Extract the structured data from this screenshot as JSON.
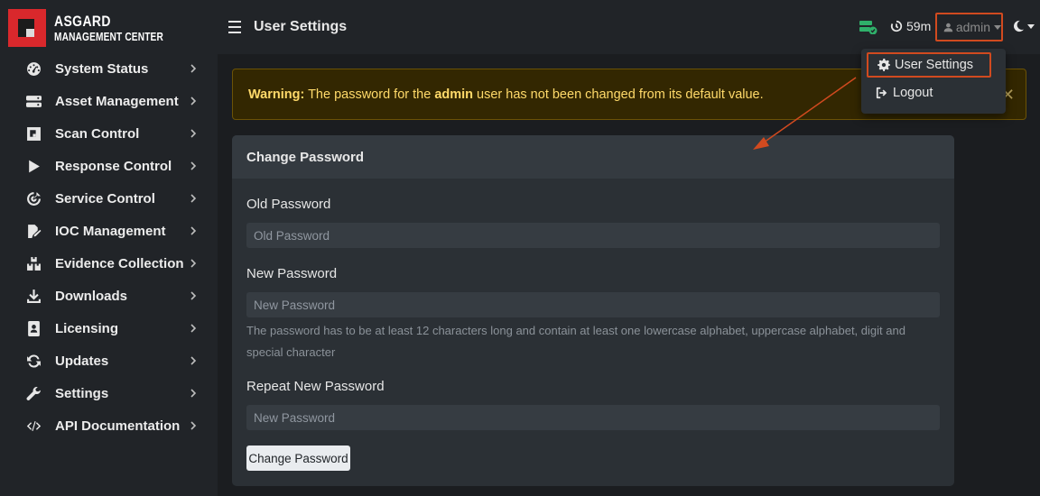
{
  "brand": {
    "line1": "ASGARD",
    "line2": "MANAGEMENT CENTER"
  },
  "sidebar": {
    "items": [
      {
        "label": "System Status",
        "icon": "gauge-icon"
      },
      {
        "label": "Asset Management",
        "icon": "server-icon"
      },
      {
        "label": "Scan Control",
        "icon": "scan-icon"
      },
      {
        "label": "Response Control",
        "icon": "play-icon"
      },
      {
        "label": "Service Control",
        "icon": "target-icon"
      },
      {
        "label": "IOC Management",
        "icon": "file-edit-icon"
      },
      {
        "label": "Evidence Collection",
        "icon": "boxes-icon"
      },
      {
        "label": "Downloads",
        "icon": "download-icon"
      },
      {
        "label": "Licensing",
        "icon": "id-card-icon"
      },
      {
        "label": "Updates",
        "icon": "sync-icon"
      },
      {
        "label": "Settings",
        "icon": "wrench-icon"
      },
      {
        "label": "API Documentation",
        "icon": "code-icon"
      }
    ]
  },
  "header": {
    "title": "User Settings",
    "timer": "59m",
    "user": "admin"
  },
  "dropdown": {
    "user_settings": "User Settings",
    "logout": "Logout"
  },
  "warning": {
    "label": "Warning:",
    "pre": " The password for the ",
    "user": "admin",
    "post": " user has not been changed from its default value."
  },
  "card": {
    "title": "Change Password",
    "old_label": "Old Password",
    "old_placeholder": "Old Password",
    "new_label": "New Password",
    "new_placeholder": "New Password",
    "hint": "The password has to be at least 12 characters long and contain at least one lowercase alphabet, uppercase alphabet, digit and special character",
    "repeat_label": "Repeat New Password",
    "repeat_placeholder": "New Password",
    "submit": "Change Password"
  },
  "colors": {
    "accent_outline": "#d14a1f",
    "warning_text": "#ffda6a",
    "server_ok": "#2fb06a",
    "logo_red": "#d9282c"
  }
}
